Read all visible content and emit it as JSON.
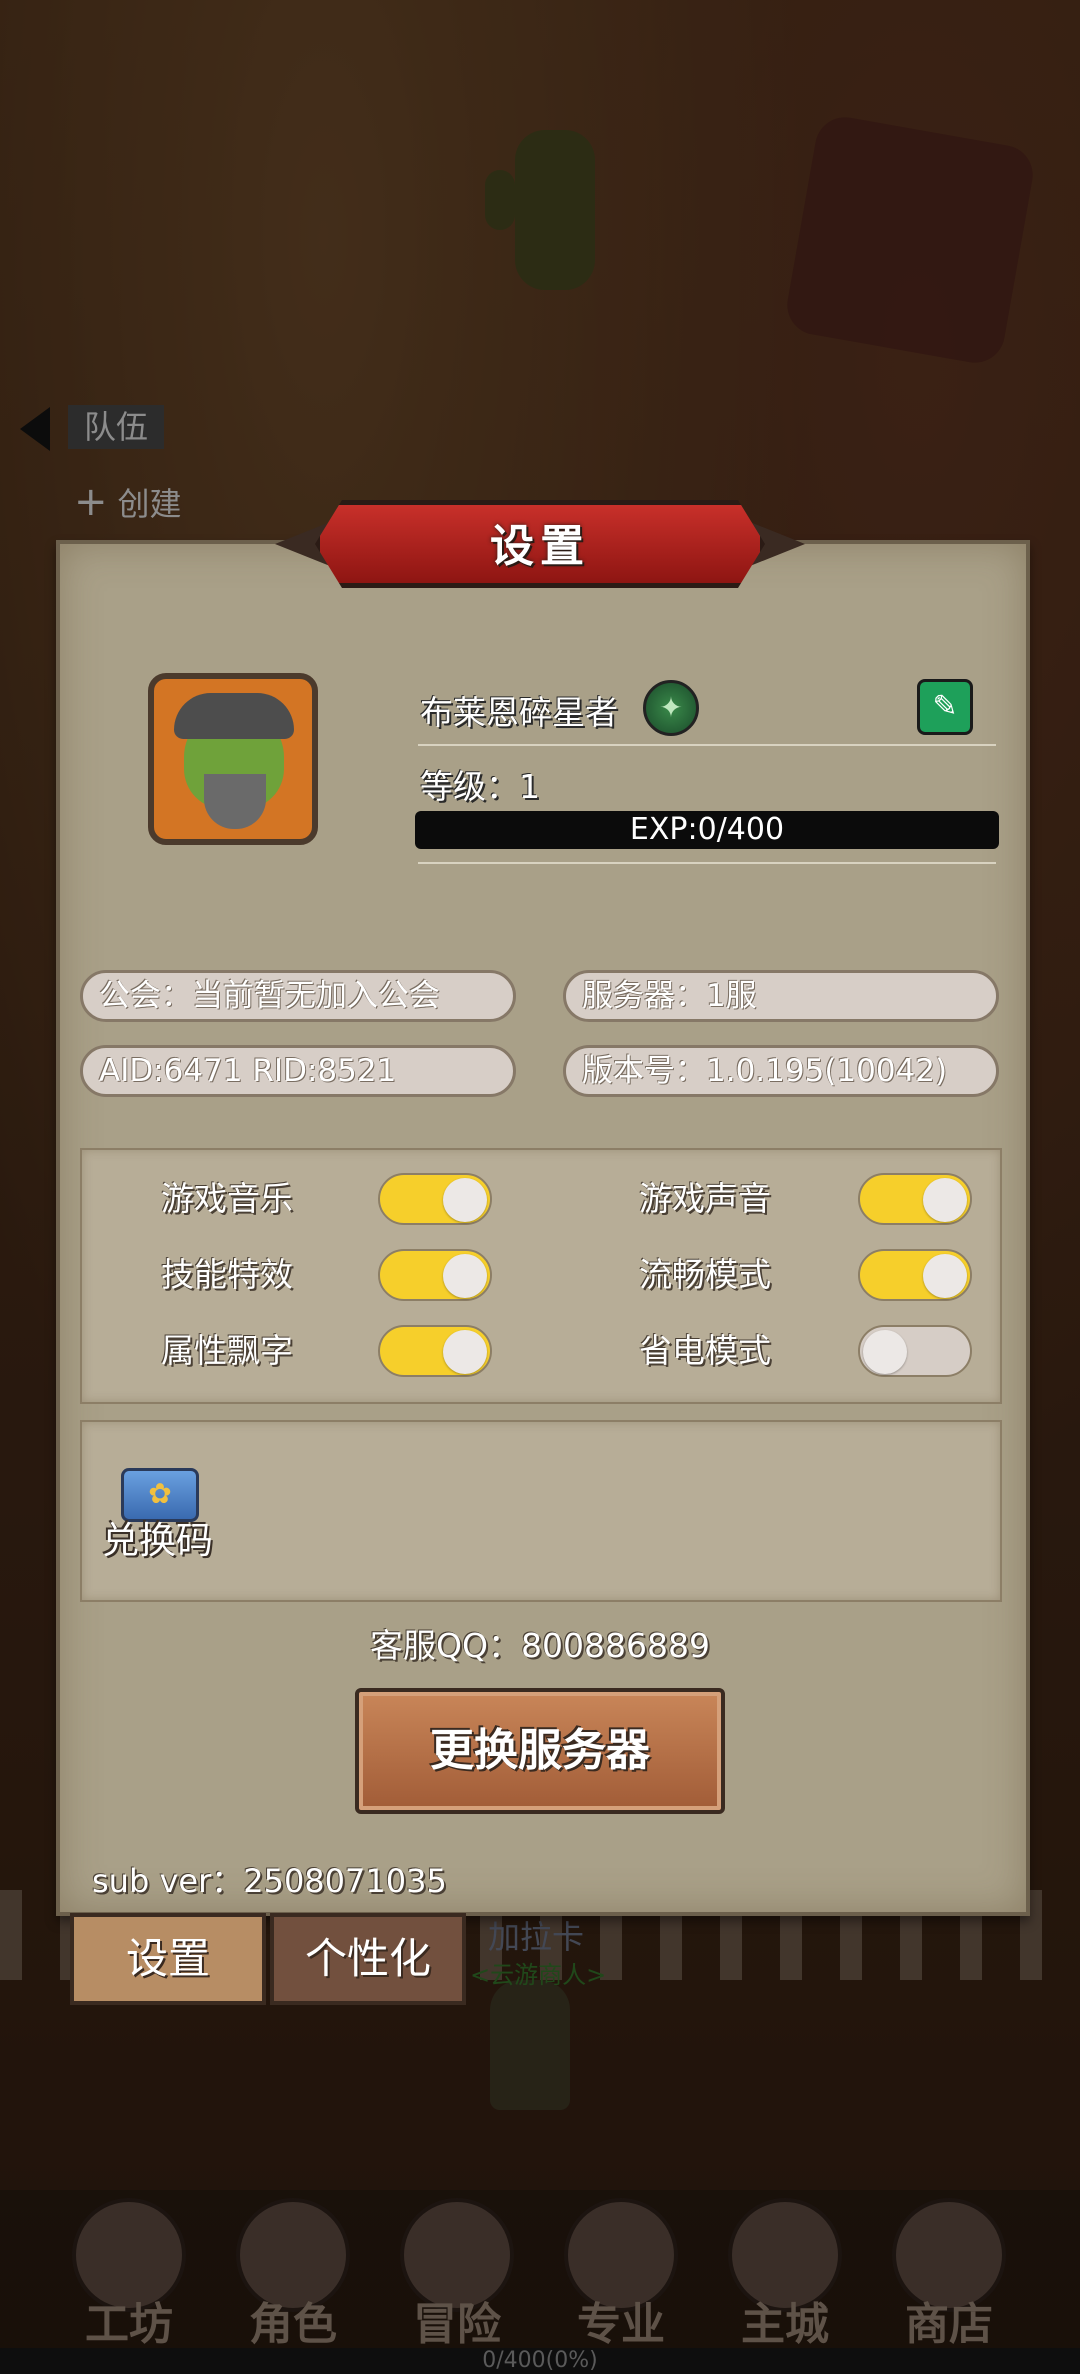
{
  "background": {
    "team_tab": "队伍",
    "create_tab": "创建"
  },
  "settings": {
    "title": "设置",
    "player": {
      "name": "布莱恩碎星者",
      "level_text": "等级：1",
      "exp_text": "EXP:0/400",
      "exp_progress": 0
    },
    "info": {
      "guild": "公会：当前暂无加入公会",
      "server": "服务器：1服",
      "ids": "AID:6471   RID:8521",
      "version": "版本号：1.0.195(10042)"
    },
    "toggles": [
      {
        "label": "游戏音乐",
        "on": true
      },
      {
        "label": "游戏声音",
        "on": true
      },
      {
        "label": "技能特效",
        "on": true
      },
      {
        "label": "流畅模式",
        "on": true
      },
      {
        "label": "属性飘字",
        "on": true
      },
      {
        "label": "省电模式",
        "on": false
      }
    ],
    "redeem_label": "兑换码",
    "support_qq": "客服QQ：800886889",
    "change_server_button": "更换服务器",
    "sub_version": "sub ver：2508071035"
  },
  "tabs": {
    "settings": "设置",
    "personalize": "个性化"
  },
  "npc": {
    "name": "加拉卡",
    "tag": "<云游商人>"
  },
  "bottom_nav": [
    "工坊",
    "角色",
    "冒险",
    "专业",
    "主城",
    "商店"
  ],
  "xp_strip": "0/400(0%)",
  "colors": {
    "toggle_on": "#f6cf2b",
    "toggle_off": "#d6cdc6",
    "panel": "#a9a088",
    "title_ribbon": "#b8221d"
  }
}
